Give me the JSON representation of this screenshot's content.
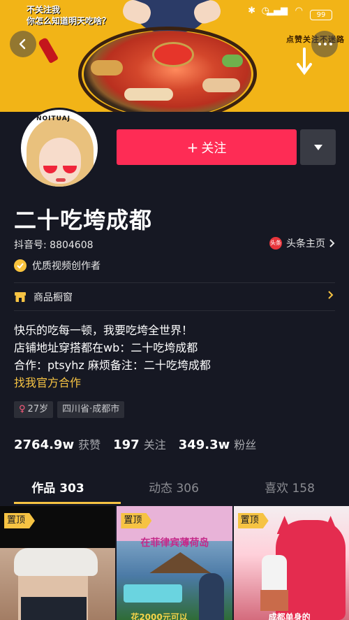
{
  "banner": {
    "caption": "不关注我\n你怎么知道明天吃啥？",
    "side_text": "点赞关注不迷路",
    "battery": "99"
  },
  "nav": {
    "back_icon": "chevron-left-icon",
    "more_icon": "more-dots-icon"
  },
  "profile": {
    "avatar_text": "NOITUAJ",
    "follow_label": "关注",
    "nickname": "二十吃垮成都",
    "douyin_id": "抖音号: 8804608",
    "toutiao_logo": "头条",
    "toutiao_label": "头条主页",
    "creator_badge": "优质视频创作者",
    "shop_window": "商品橱窗",
    "bio_lines": [
      "快乐的吃每一顿，我要吃垮全世界！",
      "店铺地址穿搭都在wb：二十吃垮成都",
      "合作：ptsyhz 麻烦备注：二十吃垮成都"
    ],
    "bio_link": "找我官方合作",
    "tags": {
      "age": "27岁",
      "location": "四川省·成都市"
    }
  },
  "stats": {
    "likes_value": "2764.9w",
    "likes_label": "获赞",
    "following_value": "197",
    "following_label": "关注",
    "followers_value": "349.3w",
    "followers_label": "粉丝"
  },
  "tabs": {
    "works": "作品 303",
    "dynamics": "动态 306",
    "likes": "喜欢 158"
  },
  "grid": {
    "pin_label": "置顶",
    "cell2_title": "在菲律宾薄荷岛",
    "cell2_bottom": "花2000元可以",
    "cell3_bottom": "成都单身的"
  },
  "colors": {
    "accent": "#fe2c55",
    "background": "#161823",
    "highlight": "#f6c343"
  }
}
